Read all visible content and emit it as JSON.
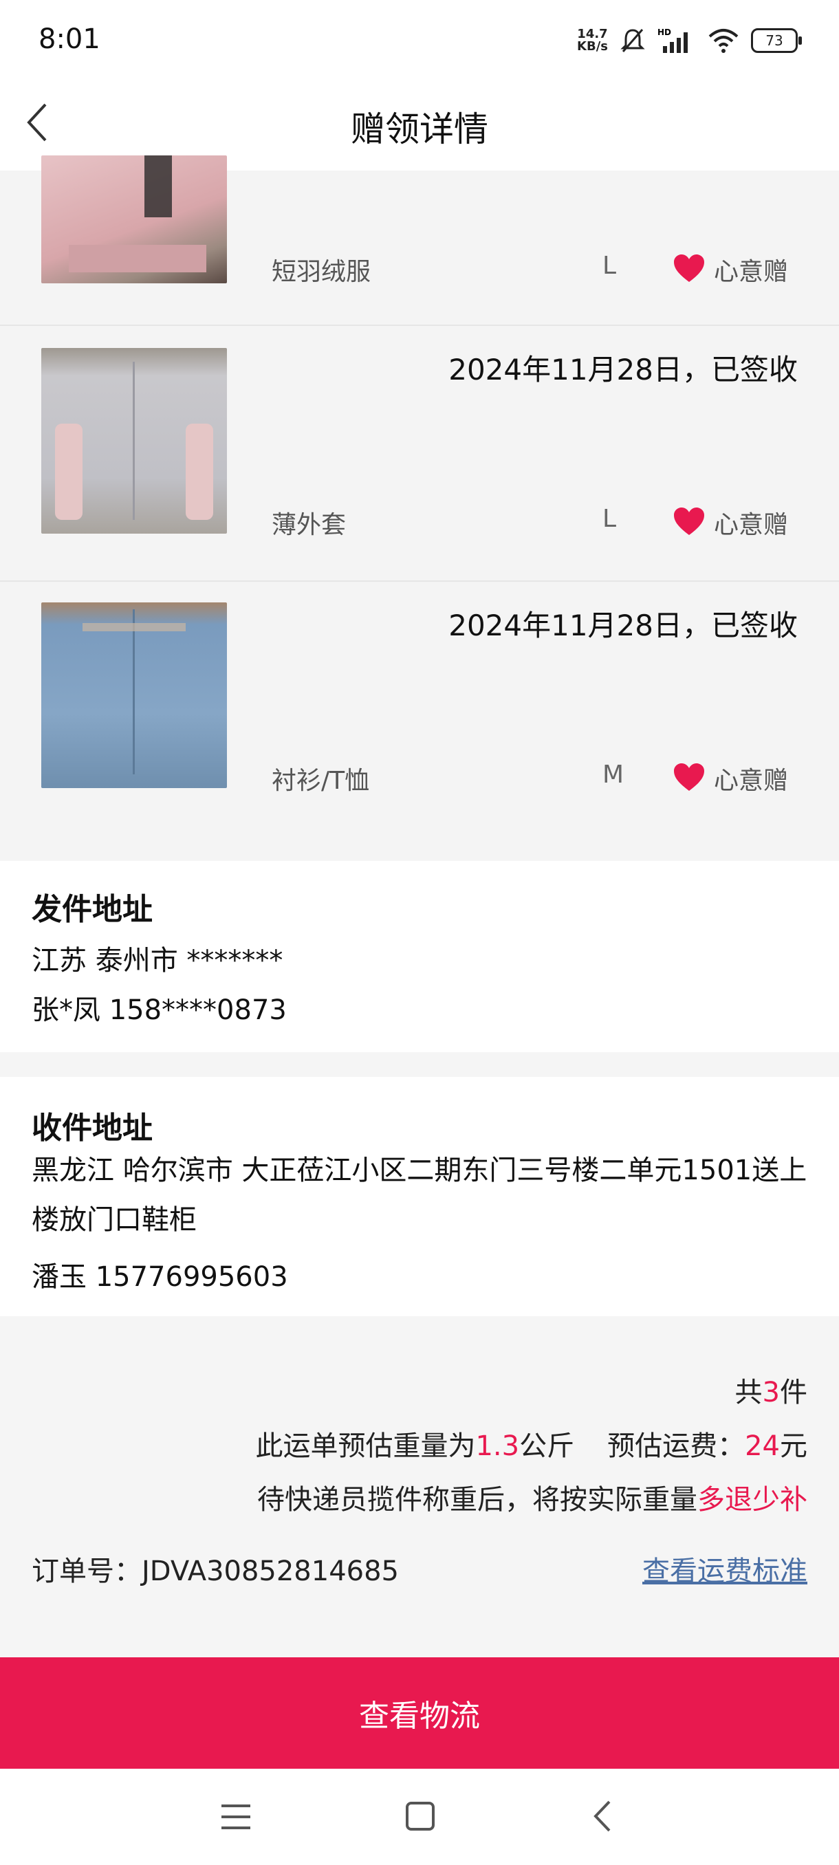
{
  "status_bar": {
    "time": "8:01",
    "speed_top": "14.7",
    "speed_bottom": "KB/s",
    "battery": "73"
  },
  "header": {
    "title": "赠领详情"
  },
  "items": [
    {
      "name": "短羽绒服",
      "size": "L",
      "gift_label": "心意赠",
      "date": ""
    },
    {
      "name": "薄外套",
      "size": "L",
      "gift_label": "心意赠",
      "date": "2024年11月28日，已签收"
    },
    {
      "name": "衬衫/T恤",
      "size": "M",
      "gift_label": "心意赠",
      "date": "2024年11月28日，已签收"
    }
  ],
  "sender": {
    "heading": "发件地址",
    "address": "江苏 泰州市 *******",
    "contact": "张*凤 158****0873"
  },
  "receiver": {
    "heading": "收件地址",
    "address": "黑龙江 哈尔滨市 大正莅江小区二期东门三号楼二单元1501送上楼放门口鞋柜",
    "contact": "潘玉 15776995603"
  },
  "summary": {
    "count_prefix": "共",
    "count": "3",
    "count_suffix": "件",
    "weight_prefix": "此运单预估重量为",
    "weight": "1.3",
    "weight_unit": "公斤",
    "fee_label": "预估运费：",
    "fee": "24",
    "fee_unit": "元",
    "note_prefix": "待快递员揽件称重后，将按实际重量",
    "note_highlight": "多退少补",
    "order_label": "订单号：",
    "order_no": "JDVA30852814685",
    "fee_standard_link": "查看运费标准"
  },
  "button": {
    "label": "查看物流"
  },
  "colors": {
    "accent": "#e8194f",
    "link": "#4a6fa5"
  }
}
